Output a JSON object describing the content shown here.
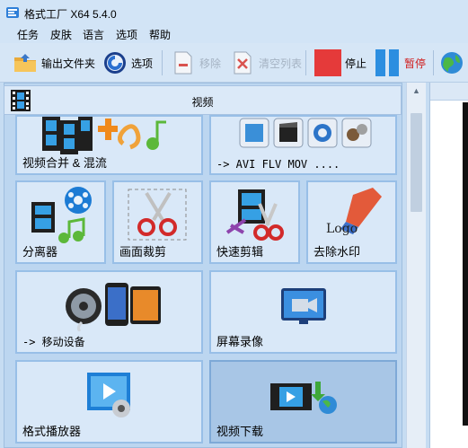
{
  "window": {
    "title": "格式工厂 X64 5.4.0"
  },
  "menu": [
    "任务",
    "皮肤",
    "语言",
    "选项",
    "帮助"
  ],
  "toolbar": {
    "output_folder": "输出文件夹",
    "options": "选项",
    "remove": "移除",
    "clear_list": "清空列表",
    "stop": "停止",
    "pause": "暂停"
  },
  "category": {
    "label": "视频"
  },
  "tiles": [
    {
      "label": "视频合并 & 混流"
    },
    {
      "label": "-> AVI FLV MOV ...."
    },
    {
      "label": "分离器"
    },
    {
      "label": "画面裁剪"
    },
    {
      "label": "快速剪辑"
    },
    {
      "label": "去除水印",
      "icon_text": "Logo"
    },
    {
      "label": "-> 移动设备"
    },
    {
      "label": "屏幕录像"
    },
    {
      "label": "格式播放器"
    },
    {
      "label": "视频下载"
    }
  ],
  "colors": {
    "accent": "#98bfe7",
    "stop": "#e53a3a",
    "pause_text": "#d01c1c"
  },
  "icons": [
    "app-icon",
    "folder-icon",
    "gear-icon",
    "remove-icon",
    "clear-list-icon",
    "stop-icon",
    "pause-icon",
    "globe-icon",
    "film-icon",
    "merge-icon",
    "multi-format-icon",
    "splitter-icon",
    "crop-icon",
    "quick-clip-icon",
    "watermark-eraser-icon",
    "mobile-device-icon",
    "screen-record-icon",
    "player-icon",
    "download-icon"
  ]
}
